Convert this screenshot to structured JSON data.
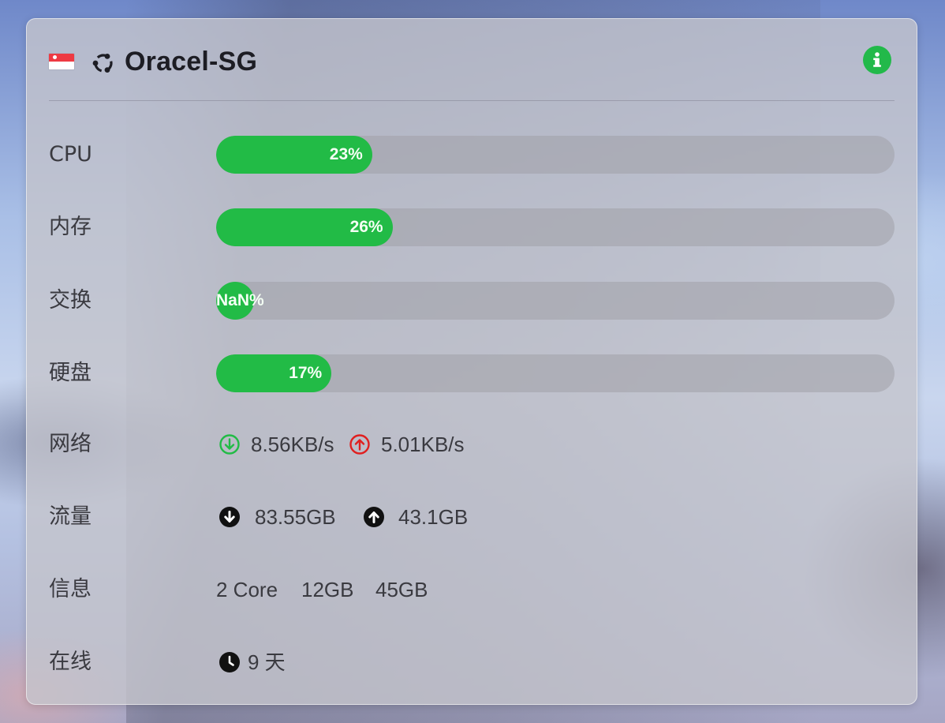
{
  "server": {
    "name": "Oracel-SG",
    "flag_icon": "singapore-flag-icon",
    "os_icon": "ubuntu-icon",
    "info_icon": "info-icon"
  },
  "colors": {
    "accent": "#22bb46",
    "upload_red": "#e02020",
    "track": "#a0a0a8"
  },
  "metrics": [
    {
      "label": "CPU",
      "percent": 23,
      "text": "23%"
    },
    {
      "label": "内存",
      "percent": 26,
      "text": "26%"
    },
    {
      "label": "交换",
      "percent": 0,
      "text": "NaN%"
    },
    {
      "label": "硬盘",
      "percent": 17,
      "text": "17%"
    }
  ],
  "network": {
    "label": "网络",
    "down_speed": "8.56KB/s",
    "up_speed": "5.01KB/s"
  },
  "traffic": {
    "label": "流量",
    "down_total": "83.55GB",
    "up_total": "43.1GB"
  },
  "info": {
    "label": "信息",
    "cores": "2 Core",
    "memory": "12GB",
    "disk": "45GB"
  },
  "uptime": {
    "label": "在线",
    "value": "9 天"
  }
}
